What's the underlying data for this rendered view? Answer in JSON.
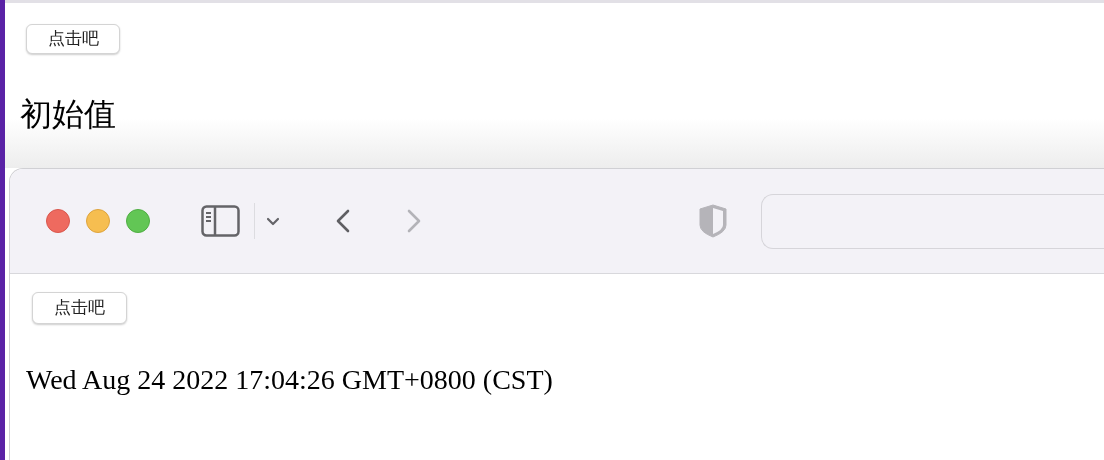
{
  "page": {
    "button": "点击吧",
    "text": "初始值"
  },
  "browser": {
    "back": {
      "disabled": false
    },
    "forward": {
      "disabled": true
    },
    "content": {
      "button": "点击吧",
      "text": "Wed Aug 24 2022 17:04:26 GMT+0800 (CST)"
    }
  }
}
